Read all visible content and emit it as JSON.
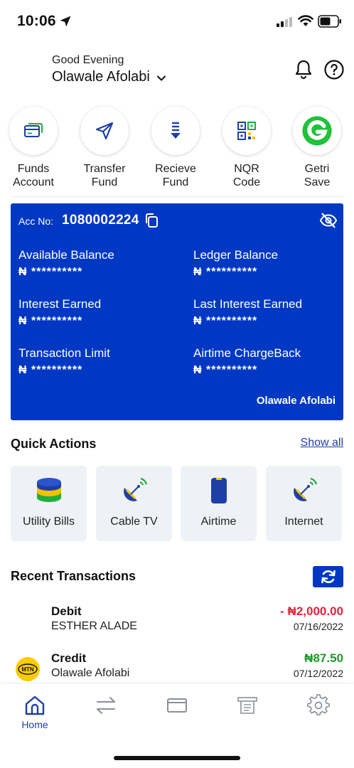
{
  "status_bar": {
    "time": "10:06"
  },
  "header": {
    "greeting": "Good Evening",
    "user_name": "Olawale Afolabi"
  },
  "shortcuts": [
    {
      "label": "Funds\nAccount",
      "icon": "card-icon"
    },
    {
      "label": "Transfer\nFund",
      "icon": "send-icon"
    },
    {
      "label": "Recieve\nFund",
      "icon": "download-arrow-icon"
    },
    {
      "label": "NQR\nCode",
      "icon": "qr-code-icon"
    },
    {
      "label": "Getri\nSave",
      "icon": "getri-logo-icon"
    }
  ],
  "account": {
    "acc_no_label": "Acc No:",
    "acc_no": "1080002224",
    "balances": [
      {
        "label": "Available Balance",
        "value": "₦ **********"
      },
      {
        "label": "Ledger Balance",
        "value": "₦ **********"
      },
      {
        "label": "Interest Earned",
        "value": "₦ **********"
      },
      {
        "label": "Last Interest Earned",
        "value": "₦ **********"
      },
      {
        "label": "Transaction Limit",
        "value": "₦ **********"
      },
      {
        "label": "Airtime ChargeBack",
        "value": "₦ **********"
      }
    ],
    "holder_name": "Olawale  Afolabi",
    "card_color": "#0038c4"
  },
  "quick_actions": {
    "title": "Quick Actions",
    "show_all": "Show all",
    "items": [
      {
        "label": "Utility Bills",
        "icon": "utility-stack-icon"
      },
      {
        "label": "Cable TV",
        "icon": "satellite-dish-icon"
      },
      {
        "label": "Airtime",
        "icon": "phone-icon"
      },
      {
        "label": "Internet",
        "icon": "satellite-dish-icon"
      }
    ]
  },
  "recent_transactions": {
    "title": "Recent Transactions",
    "items": [
      {
        "type": "Debit",
        "party": "ESTHER  ALADE",
        "amount": "- ₦2,000.00",
        "date": "07/16/2022",
        "color": "#e0243a"
      },
      {
        "type": "Credit",
        "party": "Olawale Afolabi",
        "amount": "₦87.50",
        "date": "07/12/2022",
        "color": "#1f9a2a",
        "logo_text": "MTN"
      }
    ]
  },
  "tab_bar": {
    "home_label": "Home",
    "active_color": "#1d3fa6"
  }
}
